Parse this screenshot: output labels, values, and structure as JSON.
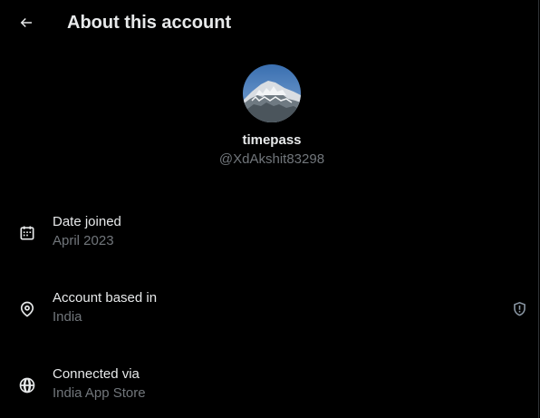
{
  "header": {
    "title": "About this account",
    "back_icon": "arrow-left-icon"
  },
  "profile": {
    "display_name": "timepass",
    "handle": "@XdAkshit83298",
    "avatar": "mountain-snow-photo"
  },
  "rows": [
    {
      "icon": "calendar-icon",
      "title": "Date joined",
      "value": "April 2023"
    },
    {
      "icon": "location-pin-icon",
      "title": "Account based in",
      "value": "India",
      "badge_icon": "shield-info-icon"
    },
    {
      "icon": "globe-icon",
      "title": "Connected via",
      "value": "India App Store"
    }
  ],
  "colors": {
    "background": "#000000",
    "primary_text": "#e7e9ea",
    "secondary_text": "#71767b",
    "divider": "#2f3336"
  }
}
